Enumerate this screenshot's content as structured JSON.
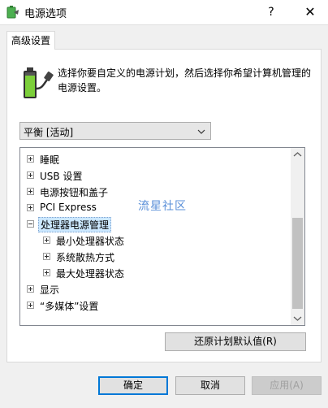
{
  "window": {
    "title": "电源选项",
    "help_glyph": "?",
    "close_glyph": "✕"
  },
  "tab": {
    "label": "高级设置"
  },
  "description": "选择你要自定义的电源计划，然后选择你希望计算机管理的电源设置。",
  "plan_select": {
    "value": "平衡 [活动]"
  },
  "tree": {
    "items": [
      {
        "label": "睡眠",
        "level": 0,
        "expanded": false
      },
      {
        "label": "USB 设置",
        "level": 0,
        "expanded": false
      },
      {
        "label": "电源按钮和盖子",
        "level": 0,
        "expanded": false
      },
      {
        "label": "PCI Express",
        "level": 0,
        "expanded": false
      },
      {
        "label": "处理器电源管理",
        "level": 0,
        "expanded": true,
        "selected": true
      },
      {
        "label": "最小处理器状态",
        "level": 1,
        "expanded": false
      },
      {
        "label": "系统散热方式",
        "level": 1,
        "expanded": false
      },
      {
        "label": "最大处理器状态",
        "level": 1,
        "expanded": false
      },
      {
        "label": "显示",
        "level": 0,
        "expanded": false
      },
      {
        "label": "“多媒体”设置",
        "level": 0,
        "expanded": false
      }
    ]
  },
  "watermark": "流星社区",
  "restore_button": "还原计划默认值(R)",
  "buttons": {
    "ok": "确定",
    "cancel": "取消",
    "apply": "应用(A)"
  },
  "colors": {
    "accent": "#0078d7",
    "selection": "#cce8ff",
    "watermark": "#5a8fd8"
  }
}
